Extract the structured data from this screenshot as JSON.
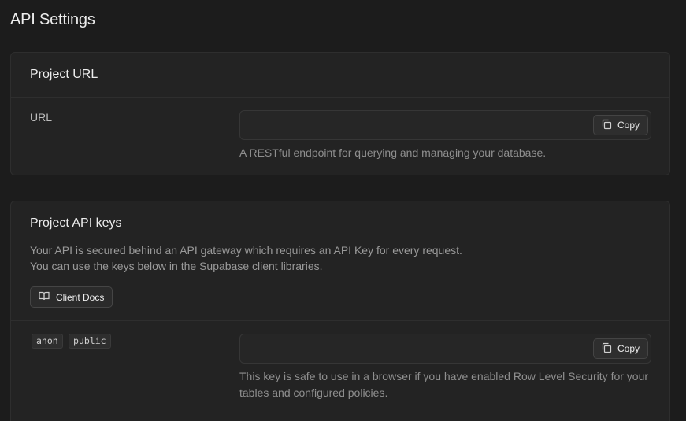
{
  "page": {
    "title": "API Settings"
  },
  "project_url": {
    "title": "Project URL",
    "label": "URL",
    "value": "",
    "copy_label": "Copy",
    "help": "A RESTful endpoint for querying and managing your database."
  },
  "api_keys": {
    "title": "Project API keys",
    "description_line1": "Your API is secured behind an API gateway which requires an API Key for every request.",
    "description_line2": "You can use the keys below in the Supabase client libraries.",
    "docs_button": "Client Docs",
    "anon_key": {
      "tags": [
        "anon",
        "public"
      ],
      "value": "",
      "copy_label": "Copy",
      "help_line1": "This key is safe to use in a browser if you have enabled Row Level Security for your",
      "help_line2": "tables and configured policies."
    }
  },
  "icons": {
    "copy": "copy-icon",
    "docs": "book-open-icon"
  }
}
